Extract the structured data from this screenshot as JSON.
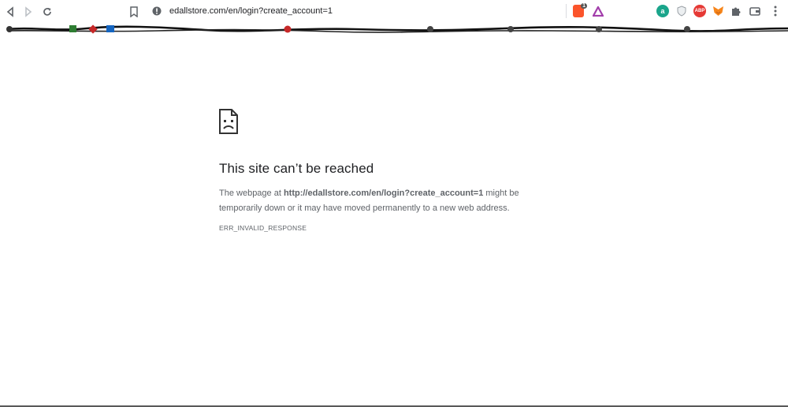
{
  "browser": {
    "url": "edallstore.com/en/login?create_account=1",
    "extensions": [
      {
        "name": "brave-shield-icon",
        "badge": "1"
      },
      {
        "name": "brave-rewards-icon"
      },
      {
        "name": "amazon-assistant-icon",
        "label": "a"
      },
      {
        "name": "privacy-badger-icon"
      },
      {
        "name": "adblock-plus-icon",
        "label": "ABP"
      },
      {
        "name": "metamask-icon"
      },
      {
        "name": "extensions-puzzle-icon"
      },
      {
        "name": "wallet-icon"
      },
      {
        "name": "menu-icon"
      }
    ]
  },
  "error": {
    "title": "This site can’t be reached",
    "desc_prefix": "The webpage at ",
    "desc_url": "http://edallstore.com/en/login?create_account=1",
    "desc_suffix": " might be temporarily down or it may have moved permanently to a new web address.",
    "code": "ERR_INVALID_RESPONSE"
  }
}
